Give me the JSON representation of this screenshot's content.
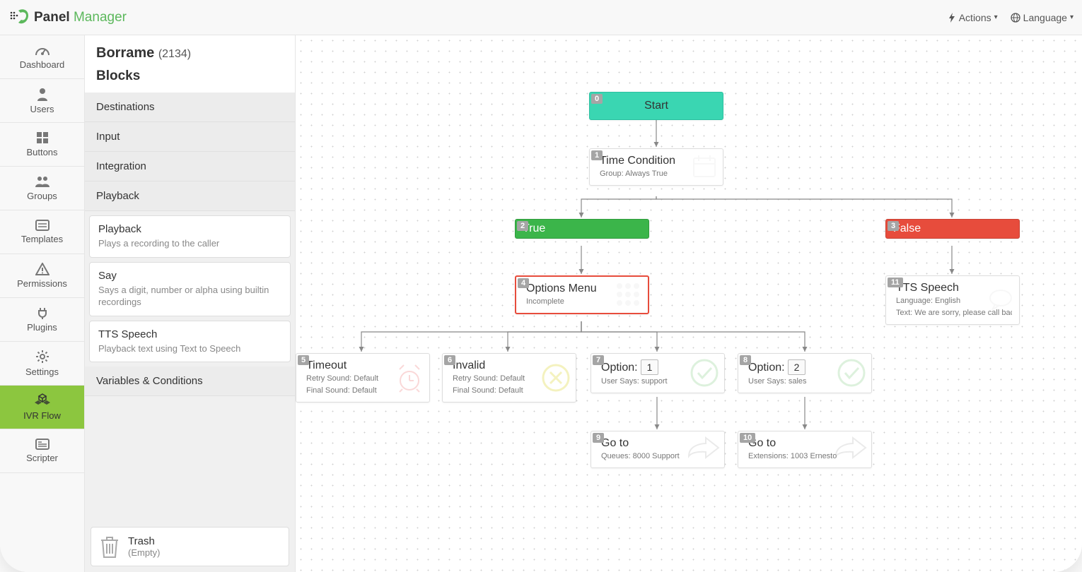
{
  "logo": {
    "text1": "Panel",
    "text2": "Manager"
  },
  "topbar": {
    "actions": "Actions",
    "language": "Language"
  },
  "sidebar": {
    "items": [
      {
        "label": "Dashboard"
      },
      {
        "label": "Users"
      },
      {
        "label": "Buttons"
      },
      {
        "label": "Groups"
      },
      {
        "label": "Templates"
      },
      {
        "label": "Permissions"
      },
      {
        "label": "Plugins"
      },
      {
        "label": "Settings"
      },
      {
        "label": "IVR Flow"
      },
      {
        "label": "Scripter"
      }
    ]
  },
  "panel": {
    "title": "Borrame",
    "count": "(2134)",
    "subtitle": "Blocks",
    "categories": {
      "destinations": "Destinations",
      "input": "Input",
      "integration": "Integration",
      "playback": "Playback",
      "variables": "Variables & Conditions"
    },
    "blocks": {
      "playback": {
        "title": "Playback",
        "desc": "Plays a recording to the caller"
      },
      "say": {
        "title": "Say",
        "desc": "Says a digit, number or alpha using builtin recordings"
      },
      "tts": {
        "title": "TTS Speech",
        "desc": "Playback text using Text to Speech"
      }
    },
    "trash": {
      "title": "Trash",
      "status": "(Empty)"
    }
  },
  "nodes": {
    "n0": {
      "badge": "0",
      "title": "Start"
    },
    "n1": {
      "badge": "1",
      "title": "Time Condition",
      "sub": "Group: Always True"
    },
    "n2": {
      "badge": "2",
      "title": "True"
    },
    "n3": {
      "badge": "3",
      "title": "False"
    },
    "n4": {
      "badge": "4",
      "title": "Options Menu",
      "sub": "Incomplete"
    },
    "n5": {
      "badge": "5",
      "title": "Timeout",
      "sub1": "Retry Sound: Default",
      "sub2": "Final Sound: Default"
    },
    "n6": {
      "badge": "6",
      "title": "Invalid",
      "sub1": "Retry Sound: Default",
      "sub2": "Final Sound: Default"
    },
    "n7": {
      "badge": "7",
      "title": "Option:",
      "opt": "1",
      "sub": "User Says: support"
    },
    "n8": {
      "badge": "8",
      "title": "Option:",
      "opt": "2",
      "sub": "User Says: sales"
    },
    "n9": {
      "badge": "9",
      "title": "Go to",
      "sub": "Queues: 8000 Support"
    },
    "n10": {
      "badge": "10",
      "title": "Go to",
      "sub": "Extensions: 1003 Ernesto"
    },
    "n11": {
      "badge": "11",
      "title": "TTS Speech",
      "sub1": "Language: English",
      "sub2": "Text: We are sorry, please call back tomorrow"
    }
  }
}
